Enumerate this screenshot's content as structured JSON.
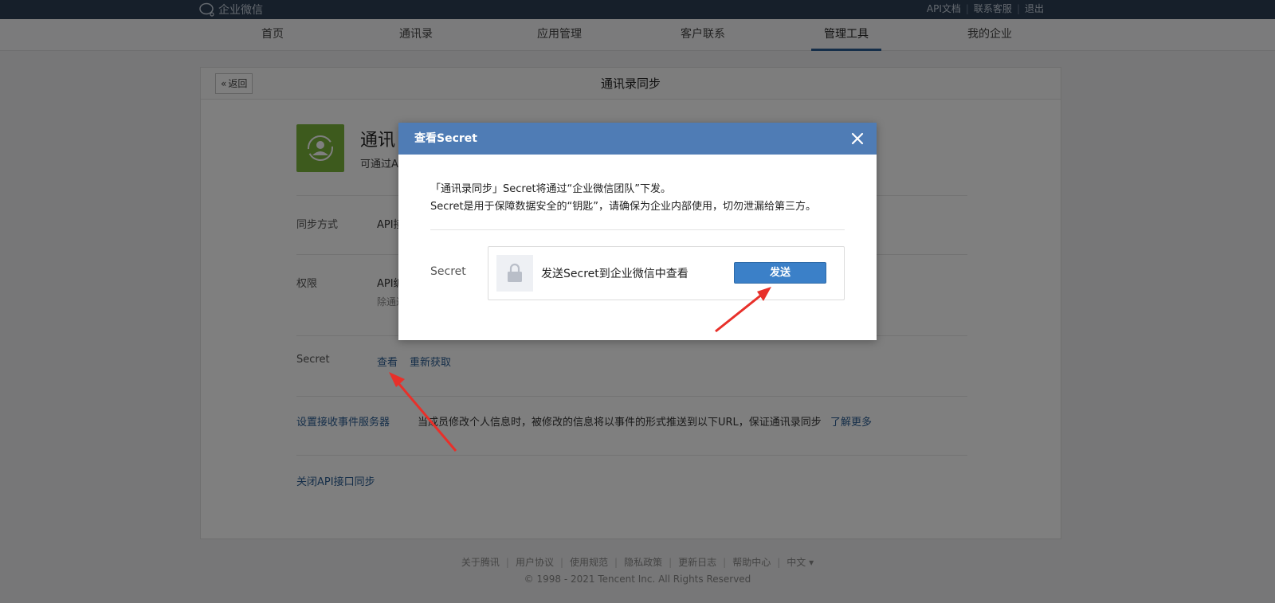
{
  "topbar": {
    "brand": "企业微信",
    "links": [
      "API文档",
      "联系客服",
      "退出"
    ]
  },
  "nav": {
    "items": [
      "首页",
      "通讯录",
      "应用管理",
      "客户联系",
      "管理工具",
      "我的企业"
    ],
    "active": "管理工具"
  },
  "panel": {
    "back_label": "返回",
    "title": "通讯录同步",
    "app_name": "通讯",
    "app_desc": "可通过A",
    "sync_label": "同步方式",
    "sync_value": "API接",
    "perm_label": "权限",
    "perm_value": "API编",
    "perm_sub": "除通过",
    "secret_label": "Secret",
    "secret_view": "查看",
    "secret_refresh": "重新获取",
    "event_label": "设置接收事件服务器",
    "event_desc": "当成员修改个人信息时，被修改的信息将以事件的形式推送到以下URL，保证通讯录同步",
    "event_more": "了解更多",
    "close_api": "关闭API接口同步"
  },
  "modal": {
    "title": "查看Secret",
    "line1": "「通讯录同步」Secret将通过“企业微信团队”下发。",
    "line2": "Secret是用于保障数据安全的“钥匙”，请确保为企业内部使用，切勿泄漏给第三方。",
    "secret_label": "Secret",
    "send_text": "发送Secret到企业微信中查看",
    "send_button": "发送"
  },
  "footer": {
    "links": [
      "关于腾讯",
      "用户协议",
      "使用规范",
      "隐私政策",
      "更新日志",
      "帮助中心",
      "中文 ▾"
    ],
    "copyright": "© 1998 - 2021 Tencent Inc. All Rights Reserved"
  },
  "colors": {
    "topbar": "#2c3e55",
    "modal_header": "#4f7cb5",
    "primary_button": "#3b80c8",
    "app_icon": "#7ab43a",
    "link": "#2a5d93",
    "arrow": "#e8302a"
  }
}
